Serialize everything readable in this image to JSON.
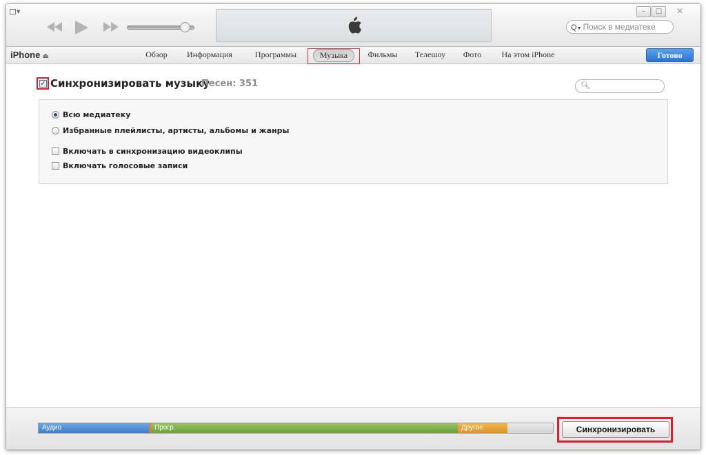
{
  "colors": {
    "accent_blue": "#2a74d6",
    "highlight_red": "#e11d2a",
    "audio": "#3c7fcf",
    "apps": "#6ea13a",
    "other": "#e2912a"
  },
  "toolbar": {
    "search_placeholder": "Поиск в медиатеке",
    "icons": [
      "menu-icon",
      "rewind-icon",
      "play-icon",
      "fast-forward-icon",
      "volume-slider",
      "apple-logo-icon",
      "search-icon"
    ],
    "window_close": "✕"
  },
  "tabsbar": {
    "device": "iPhone",
    "tabs": [
      {
        "label": "Обзор",
        "active": false
      },
      {
        "label": "Информация",
        "active": false
      },
      {
        "label": "Программы",
        "active": false
      },
      {
        "label": "Музыка",
        "active": true
      },
      {
        "label": "Фильмы",
        "active": false
      },
      {
        "label": "Телешоу",
        "active": false
      },
      {
        "label": "Фото",
        "active": false
      },
      {
        "label": "На этом iPhone",
        "active": false
      }
    ],
    "done_label": "Готово"
  },
  "music": {
    "sync_label": "Синхронизировать музыку",
    "sync_checked": true,
    "song_count": "Песен: 351",
    "options": {
      "all_library": "Всю медиатеку",
      "selected": "Избранные плейлисты, артисты, альбомы и жанры",
      "include_videos": "Включать в синхронизацию видеоклипы",
      "include_voice": "Включать голосовые записи"
    }
  },
  "capacity": {
    "audio": "Аудио",
    "apps": "Прогр.",
    "other": "Другое"
  },
  "sync_button": "Синхронизировать"
}
